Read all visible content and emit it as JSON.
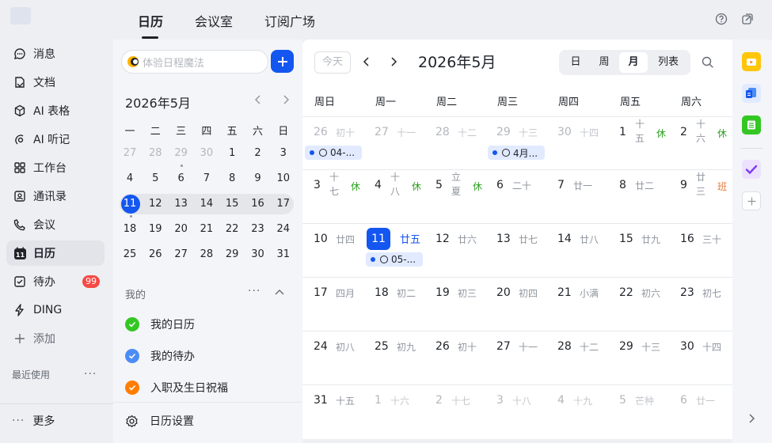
{
  "nav": {
    "items": [
      {
        "label": "消息",
        "icon": "chat-icon"
      },
      {
        "label": "文档",
        "icon": "document-icon"
      },
      {
        "label": "AI 表格",
        "icon": "ai-table-icon"
      },
      {
        "label": "AI 听记",
        "icon": "ai-notes-icon"
      },
      {
        "label": "工作台",
        "icon": "workspace-icon"
      },
      {
        "label": "通讯录",
        "icon": "contacts-icon"
      },
      {
        "label": "会议",
        "icon": "phone-icon"
      },
      {
        "label": "日历",
        "icon": "calendar-icon",
        "badge": "11"
      },
      {
        "label": "待办",
        "icon": "todo-icon",
        "count": "99"
      },
      {
        "label": "DING",
        "icon": "lightning-icon"
      },
      {
        "label": "添加",
        "icon": "plus-icon"
      }
    ],
    "recent_label": "最近使用",
    "recent_more": "···",
    "more_label": "更多",
    "more_icon": "···"
  },
  "top": {
    "tabs": [
      "日历",
      "会议室",
      "订阅广场"
    ],
    "help_icon": "help-icon",
    "share_icon": "share-icon"
  },
  "left": {
    "search_placeholder": "体验日程魔法",
    "mini_title": "2026年5月",
    "weekdays": [
      "一",
      "二",
      "三",
      "四",
      "五",
      "六",
      "日"
    ],
    "mini_weeks": [
      [
        {
          "d": "27",
          "m": true
        },
        {
          "d": "28",
          "m": true
        },
        {
          "d": "29",
          "m": true
        },
        {
          "d": "30",
          "m": true
        },
        {
          "d": "1"
        },
        {
          "d": "2"
        },
        {
          "d": "3"
        }
      ],
      [
        {
          "d": "4"
        },
        {
          "d": "5"
        },
        {
          "d": "6"
        },
        {
          "d": "7"
        },
        {
          "d": "8"
        },
        {
          "d": "9"
        },
        {
          "d": "10"
        }
      ],
      [
        {
          "d": "11"
        },
        {
          "d": "12"
        },
        {
          "d": "13"
        },
        {
          "d": "14"
        },
        {
          "d": "15"
        },
        {
          "d": "16"
        },
        {
          "d": "17"
        }
      ],
      [
        {
          "d": "18"
        },
        {
          "d": "19"
        },
        {
          "d": "20"
        },
        {
          "d": "21"
        },
        {
          "d": "22"
        },
        {
          "d": "23"
        },
        {
          "d": "24"
        }
      ],
      [
        {
          "d": "25"
        },
        {
          "d": "26"
        },
        {
          "d": "27"
        },
        {
          "d": "28"
        },
        {
          "d": "29"
        },
        {
          "d": "30"
        },
        {
          "d": "31"
        }
      ]
    ],
    "mine_label": "我的",
    "mine_more": "···",
    "calendars": [
      {
        "label": "我的日历",
        "color": "#34c724"
      },
      {
        "label": "我的待办",
        "color": "#4c8cf5"
      },
      {
        "label": "入职及生日祝福",
        "color": "#ff7d00"
      }
    ],
    "settings_label": "日历设置"
  },
  "main": {
    "today_label": "今天",
    "title": "2026年5月",
    "views": [
      "日",
      "周",
      "月",
      "列表"
    ],
    "active_view": "月",
    "weekday_headers": [
      "周日",
      "周一",
      "周二",
      "周三",
      "周四",
      "周五",
      "周六"
    ],
    "weeks": [
      [
        {
          "d": "26",
          "l": "初十",
          "m": true
        },
        {
          "d": "27",
          "l": "十一",
          "m": true
        },
        {
          "d": "28",
          "l": "十二",
          "m": true
        },
        {
          "d": "29",
          "l": "十三",
          "m": true
        },
        {
          "d": "30",
          "l": "十四",
          "m": true
        },
        {
          "d": "1",
          "l": "十五",
          "h": "休"
        },
        {
          "d": "2",
          "l": "十六",
          "h": "休"
        }
      ],
      [
        {
          "d": "3",
          "l": "十七",
          "h": "休"
        },
        {
          "d": "4",
          "l": "十八",
          "h": "休"
        },
        {
          "d": "5",
          "l": "立夏",
          "h": "休"
        },
        {
          "d": "6",
          "l": "二十"
        },
        {
          "d": "7",
          "l": "廿一"
        },
        {
          "d": "8",
          "l": "廿二"
        },
        {
          "d": "9",
          "l": "廿三",
          "h": "班"
        }
      ],
      [
        {
          "d": "10",
          "l": "廿四"
        },
        {
          "d": "11",
          "l": "廿五",
          "today": true
        },
        {
          "d": "12",
          "l": "廿六"
        },
        {
          "d": "13",
          "l": "廿七"
        },
        {
          "d": "14",
          "l": "廿八"
        },
        {
          "d": "15",
          "l": "廿九"
        },
        {
          "d": "16",
          "l": "三十"
        }
      ],
      [
        {
          "d": "17",
          "l": "四月"
        },
        {
          "d": "18",
          "l": "初二"
        },
        {
          "d": "19",
          "l": "初三"
        },
        {
          "d": "20",
          "l": "初四"
        },
        {
          "d": "21",
          "l": "小满"
        },
        {
          "d": "22",
          "l": "初六"
        },
        {
          "d": "23",
          "l": "初七"
        }
      ],
      [
        {
          "d": "24",
          "l": "初八"
        },
        {
          "d": "25",
          "l": "初九"
        },
        {
          "d": "26",
          "l": "初十"
        },
        {
          "d": "27",
          "l": "十一"
        },
        {
          "d": "28",
          "l": "十二"
        },
        {
          "d": "29",
          "l": "十三"
        },
        {
          "d": "30",
          "l": "十四"
        }
      ],
      [
        {
          "d": "31",
          "l": "十五"
        },
        {
          "d": "1",
          "l": "十六",
          "m": true
        },
        {
          "d": "2",
          "l": "十七",
          "m": true
        },
        {
          "d": "3",
          "l": "十八",
          "m": true
        },
        {
          "d": "4",
          "l": "十九",
          "m": true
        },
        {
          "d": "5",
          "l": "芒种",
          "m": true
        },
        {
          "d": "6",
          "l": "廿一",
          "m": true
        }
      ]
    ],
    "events": [
      {
        "week": 0,
        "day": 0,
        "label": "04-..."
      },
      {
        "week": 0,
        "day": 3,
        "label": "4月..."
      },
      {
        "week": 2,
        "day": 1,
        "label": "05-..."
      }
    ]
  },
  "rail": {
    "apps": [
      "video-app-icon",
      "docs-app-icon",
      "sheet-app-icon",
      "todo-app-icon"
    ],
    "add_icon": "plus-icon",
    "expand_icon": "chevron-right-icon"
  }
}
